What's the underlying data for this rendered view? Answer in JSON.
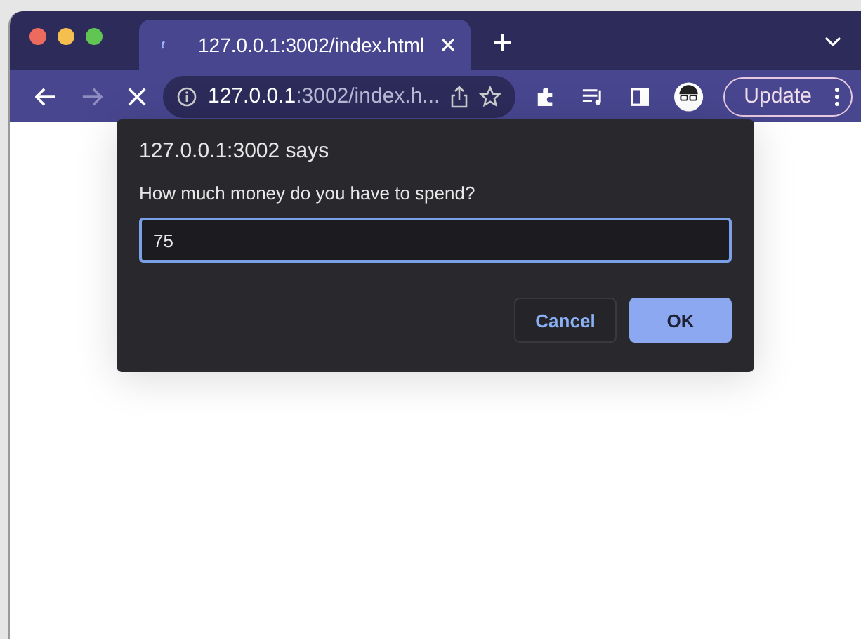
{
  "tab": {
    "title": "127.0.0.1:3002/index.html",
    "loading": true
  },
  "address_bar": {
    "host": "127.0.0.1",
    "rest": ":3002/index.h..."
  },
  "update_button": {
    "label": "Update"
  },
  "dialog": {
    "title": "127.0.0.1:3002 says",
    "message": "How much money do you have to spend?",
    "value": "75",
    "buttons": [
      {
        "label": "Cancel",
        "kind": "secondary"
      },
      {
        "label": "OK",
        "kind": "primary"
      }
    ]
  }
}
